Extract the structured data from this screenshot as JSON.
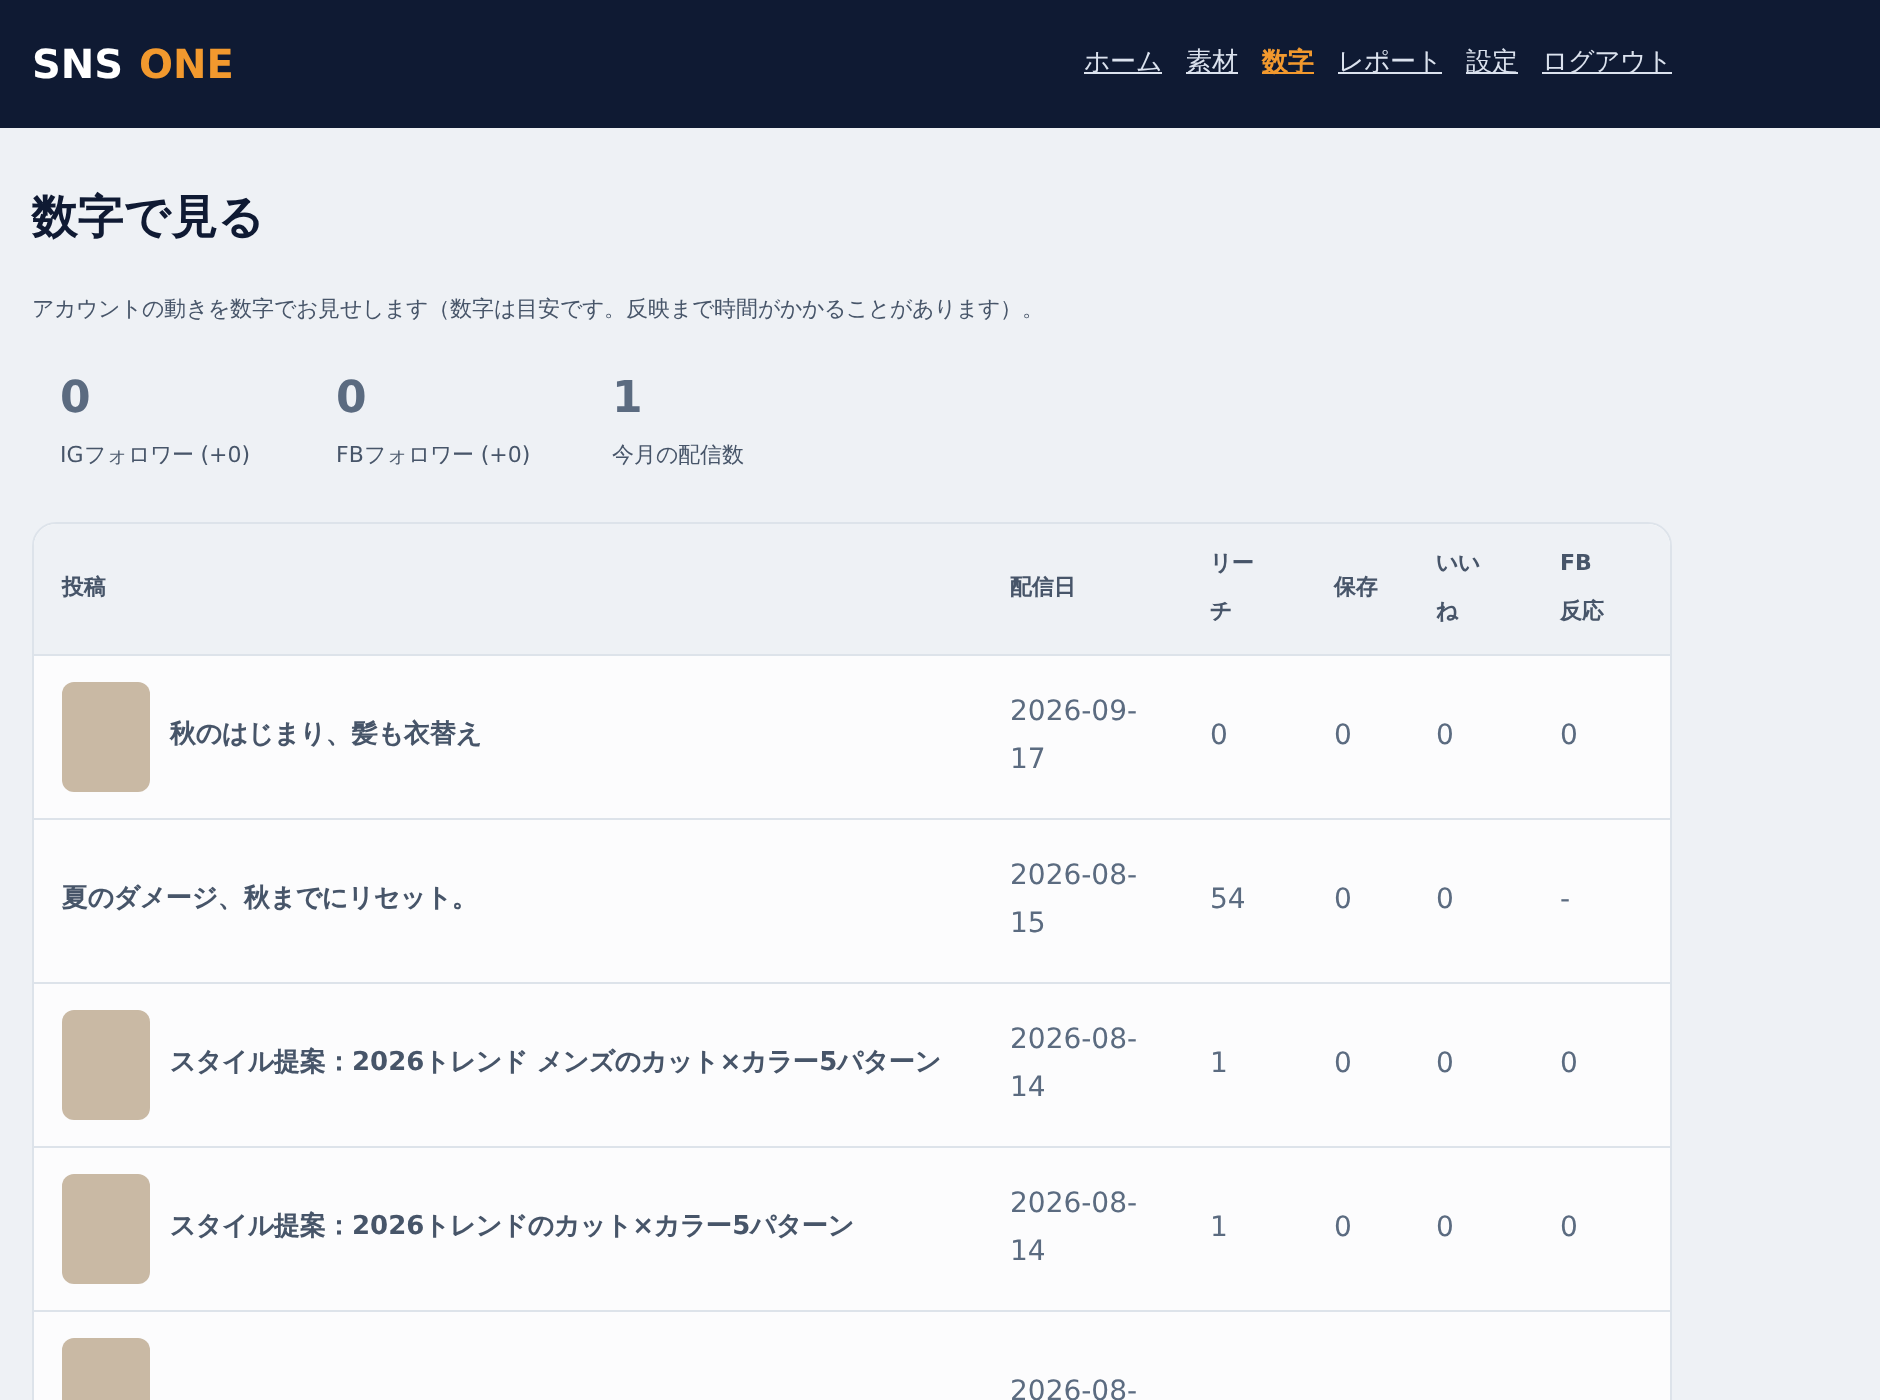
{
  "header": {
    "logo": {
      "primary": "SNS",
      "accent": "ONE"
    },
    "nav": [
      {
        "label": "ホーム",
        "selected": false
      },
      {
        "label": "素材",
        "selected": false
      },
      {
        "label": "数字",
        "selected": true
      },
      {
        "label": "レポート",
        "selected": false
      },
      {
        "label": "設定",
        "selected": false
      },
      {
        "label": "ログアウト",
        "selected": false
      }
    ]
  },
  "page": {
    "title": "数字で見る",
    "description": "アカウントの動きを数字でお見せします（数字は目安です。反映まで時間がかかることがあります）。"
  },
  "stats": [
    {
      "value": "0",
      "label": "IGフォロワー (+0)"
    },
    {
      "value": "0",
      "label": "FBフォロワー (+0)"
    },
    {
      "value": "1",
      "label": "今月の配信数"
    }
  ],
  "table": {
    "columns": [
      "投稿",
      "配信日",
      "リーチ",
      "保存",
      "いいね",
      "FB反応"
    ],
    "rows": [
      {
        "has_image": true,
        "post": "秋のはじまり、髪も衣替え",
        "date": "2026-09-17",
        "reach": "0",
        "saves": "0",
        "likes": "0",
        "fb": "0"
      },
      {
        "has_image": false,
        "post": "夏のダメージ、秋までにリセット。",
        "date": "2026-08-15",
        "reach": "54",
        "saves": "0",
        "likes": "0",
        "fb": "-"
      },
      {
        "has_image": true,
        "post": "スタイル提案：2026トレンド メンズのカット×カラー5パターン",
        "date": "2026-08-14",
        "reach": "1",
        "saves": "0",
        "likes": "0",
        "fb": "0"
      },
      {
        "has_image": true,
        "post": "スタイル提案：2026トレンドのカット×カラー5パターン",
        "date": "2026-08-14",
        "reach": "1",
        "saves": "0",
        "likes": "0",
        "fb": "0"
      },
      {
        "has_image": true,
        "date": "2026-08-"
      }
    ]
  }
}
